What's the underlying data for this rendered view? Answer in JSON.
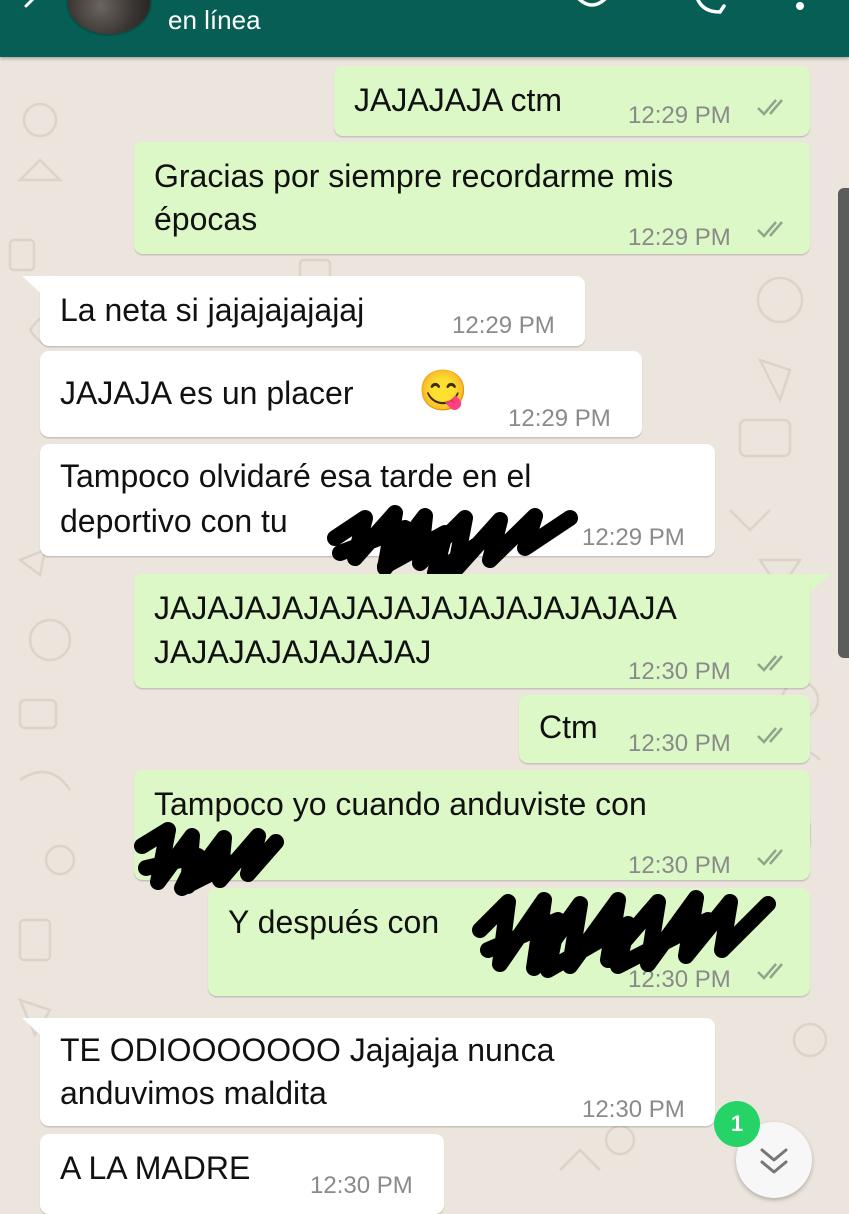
{
  "header": {
    "status": "en línea",
    "background_color": "#075e54"
  },
  "colors": {
    "outgoing_bubble": "#dcf8c6",
    "incoming_bubble": "#ffffff",
    "chat_background": "#ece5dd",
    "read_ticks": "#92a58c",
    "badge": "#25d366"
  },
  "messages": [
    {
      "direction": "outgoing",
      "lines": [
        "JAJAJAJA ctm"
      ],
      "time": "12:29 PM",
      "ticks": "double-check"
    },
    {
      "direction": "outgoing",
      "lines": [
        "Gracias por siempre recordarme mis",
        "épocas"
      ],
      "time": "12:29 PM",
      "ticks": "double-check"
    },
    {
      "direction": "incoming",
      "lines": [
        "La neta si jajajajajajaj"
      ],
      "time": "12:29 PM"
    },
    {
      "direction": "incoming",
      "lines": [
        "JAJAJA es un placer"
      ],
      "emoji": "😋",
      "time": "12:29 PM"
    },
    {
      "direction": "incoming",
      "lines": [
        "Tampoco olvidaré esa tarde en el",
        "deportivo con tu"
      ],
      "time": "12:29 PM",
      "redacted": true
    },
    {
      "direction": "outgoing",
      "lines": [
        "JAJAJAJAJAJAJAJAJAJAJAJAJAJA",
        "JAJAJAJAJAJAJAJ"
      ],
      "time": "12:30 PM",
      "ticks": "double-check"
    },
    {
      "direction": "outgoing",
      "lines": [
        "Ctm"
      ],
      "time": "12:30 PM",
      "ticks": "double-check"
    },
    {
      "direction": "outgoing",
      "lines": [
        "Tampoco yo cuando anduviste con"
      ],
      "time": "12:30 PM",
      "ticks": "double-check",
      "redacted": true
    },
    {
      "direction": "outgoing",
      "lines": [
        "Y después con"
      ],
      "time": "12:30 PM",
      "ticks": "double-check",
      "redacted": true
    },
    {
      "direction": "incoming",
      "lines": [
        "TE ODIOOOOOOO Jajajaja nunca",
        "anduvimos maldita"
      ],
      "time": "12:30 PM"
    },
    {
      "direction": "incoming",
      "lines": [
        "A LA MADRE"
      ],
      "time": "12:30 PM"
    }
  ],
  "scroll_button": {
    "icon": "double-chevron-down-icon",
    "unread_count": "1"
  }
}
